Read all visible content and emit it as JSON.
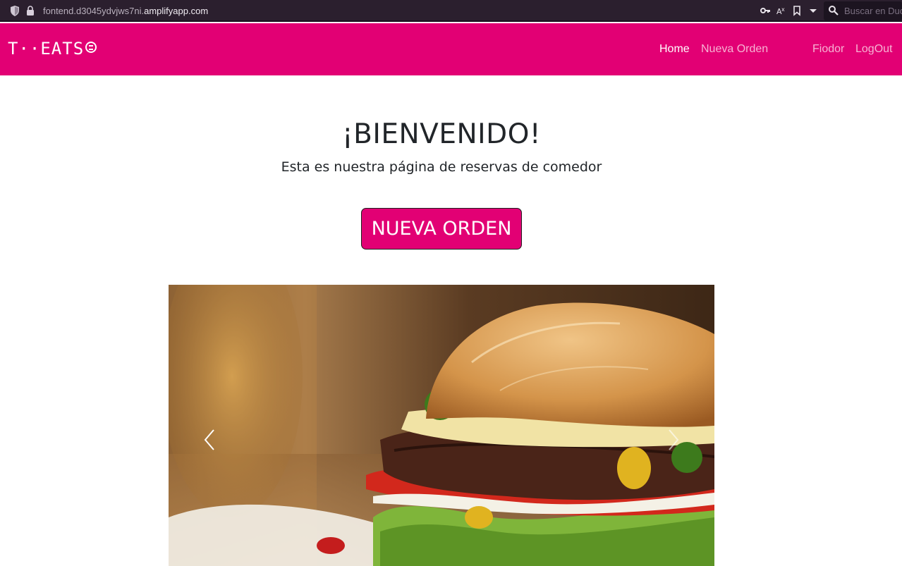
{
  "browser": {
    "url_prefix": "fontend.d3045ydvjws7ni.",
    "url_host": "amplifyapp.com",
    "search_placeholder": "Buscar en Duc"
  },
  "navbar": {
    "brand": "T··EATS",
    "links": [
      {
        "label": "Home",
        "active": true
      },
      {
        "label": "Nueva Orden",
        "active": false
      }
    ],
    "user": "Fiodor",
    "logout": "LogOut"
  },
  "hero": {
    "title": "¡BIENVENIDO!",
    "subtitle": "Esta es nuestra página de reservas de comedor",
    "cta_label": "NUEVA ORDEN"
  },
  "carousel": {
    "image": "burger-photo",
    "prev_icon": "chevron-left-icon",
    "next_icon": "chevron-right-icon"
  },
  "colors": {
    "brand": "#e20074",
    "text": "#212529",
    "browser_chrome": "#2b1f2e"
  }
}
